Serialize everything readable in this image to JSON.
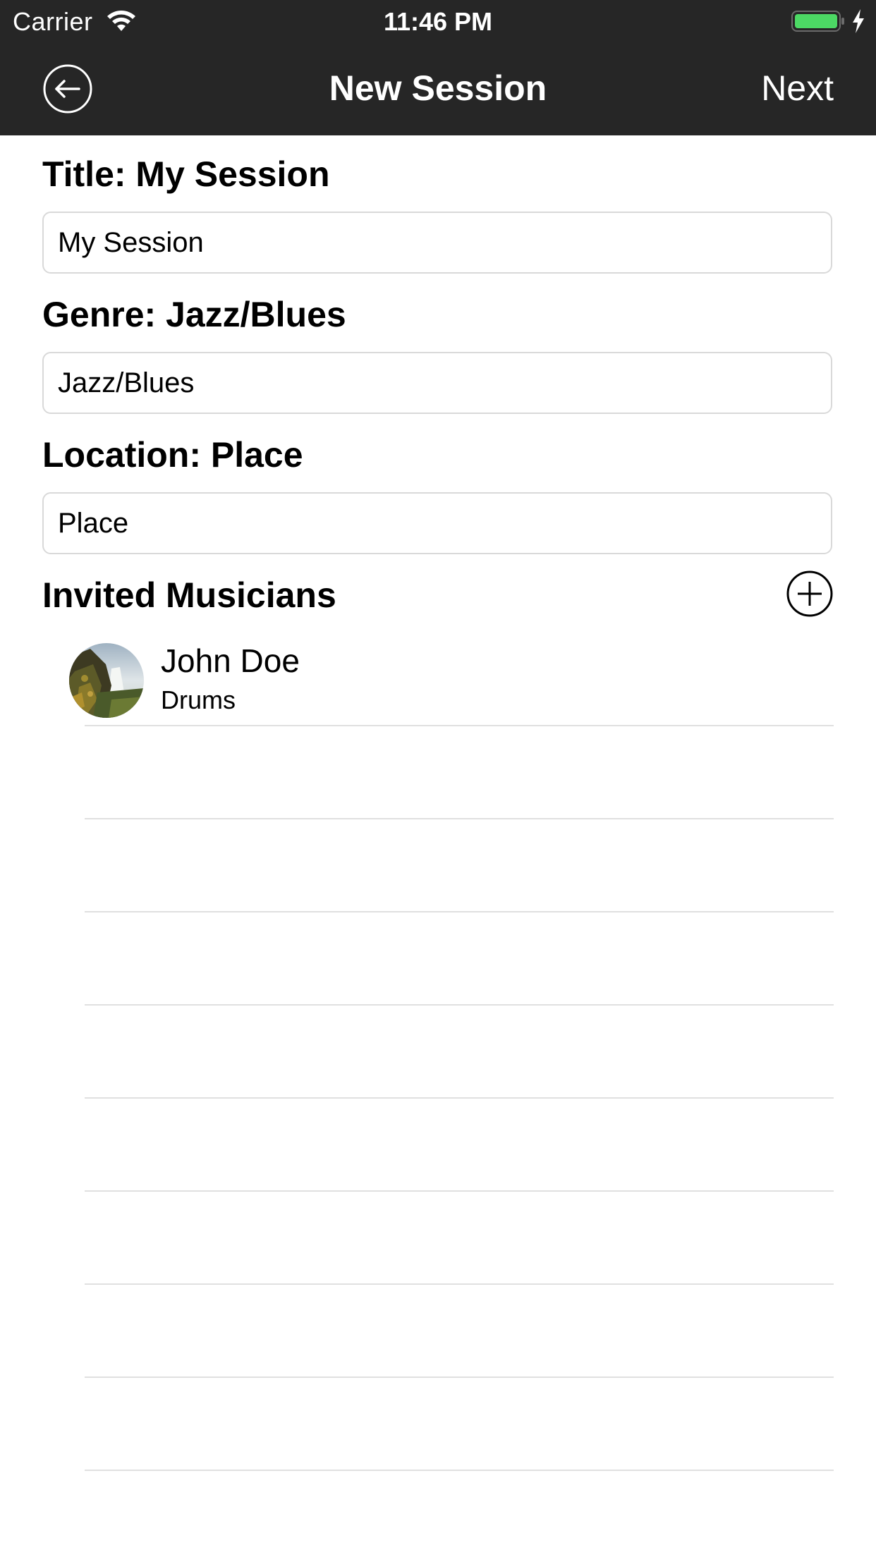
{
  "status_bar": {
    "carrier": "Carrier",
    "time": "11:46 PM",
    "battery_color": "#4cd964",
    "icons": [
      "wifi-icon",
      "battery-icon",
      "charging-icon"
    ]
  },
  "nav": {
    "title": "New Session",
    "next_label": "Next",
    "back_icon": "back-arrow-circle-icon",
    "background": "#262626"
  },
  "form": {
    "title": {
      "label": "Title: My Session",
      "value": "My Session"
    },
    "genre": {
      "label": "Genre: Jazz/Blues",
      "value": "Jazz/Blues"
    },
    "location": {
      "label": "Location: Place",
      "value": "Place"
    }
  },
  "musicians": {
    "header": "Invited Musicians",
    "add_icon": "plus-circle-icon",
    "items": [
      {
        "name": "John Doe",
        "instrument": "Drums",
        "avatar": "waterfall-landscape-photo"
      }
    ]
  }
}
